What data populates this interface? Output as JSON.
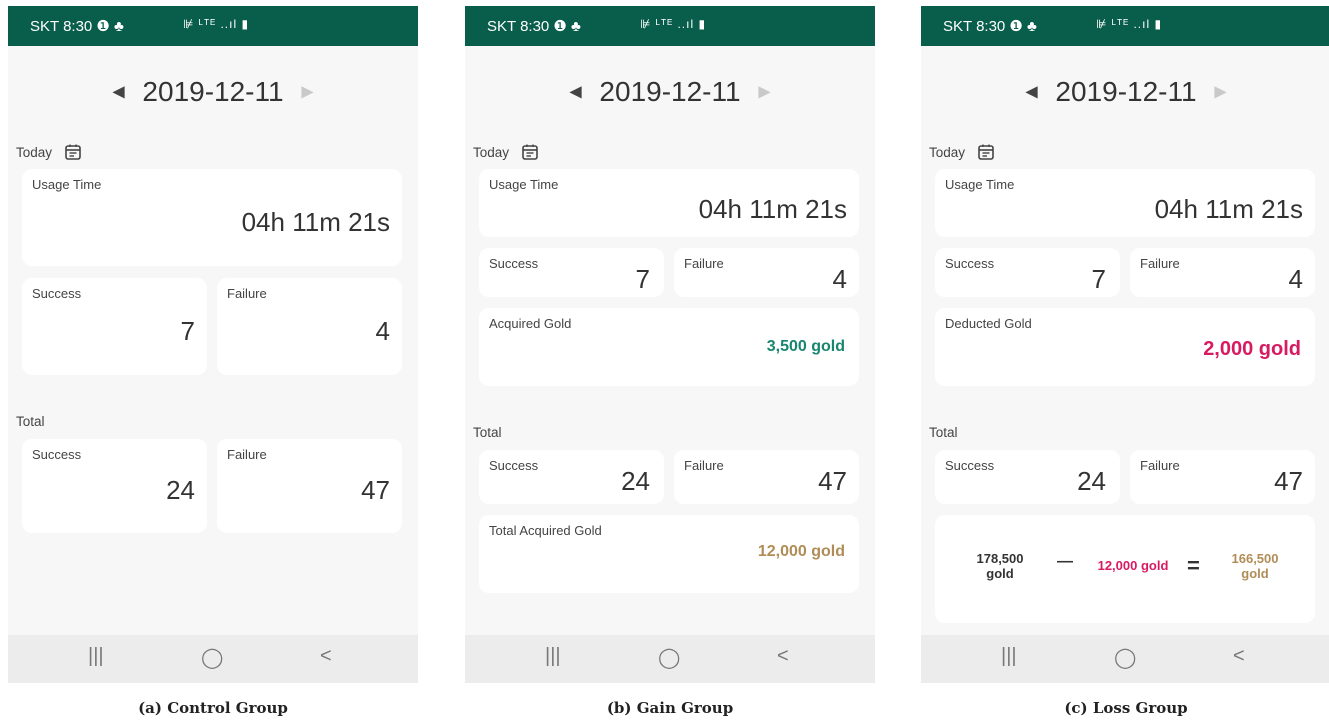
{
  "status_bar": {
    "carrier_time": "SKT 8:30 ❶ ♣",
    "icons": "⊯ ᴸᵀᴱ ..ıl ▮"
  },
  "nav": {
    "prev": "◀",
    "next": "▶",
    "date": "2019-12-11"
  },
  "labels": {
    "today": "Today",
    "total": "Total",
    "usage_time": "Usage Time",
    "success": "Success",
    "failure": "Failure"
  },
  "today_stats": {
    "usage_time": "04h 11m 21s",
    "success": "7",
    "failure": "4"
  },
  "total_stats": {
    "success": "24",
    "failure": "47"
  },
  "gain_group": {
    "acquired_label": "Acquired Gold",
    "acquired_value": "3,500 gold",
    "total_acquired_label": "Total Acquired Gold",
    "total_acquired_value": "12,000 gold"
  },
  "loss_group": {
    "deducted_label": "Deducted Gold",
    "deducted_value": "2,000 gold",
    "eq_left_1": "178,500",
    "eq_left_2": "gold",
    "eq_minus": "—",
    "eq_mid": "12,000 gold",
    "eq_equals": "=",
    "eq_right_1": "166,500",
    "eq_right_2": "gold"
  },
  "bottom_nav": {
    "recents": "|||",
    "home": "◯",
    "back": "<"
  },
  "captions": {
    "control": "(a) Control Group",
    "gain": "(b) Gain Group",
    "loss": "(c) Loss Group"
  },
  "colors": {
    "status_bar": "#085d4b",
    "gain_gold": "#17866f",
    "loss_red": "#d81b60",
    "total_gold": "#b08d57"
  }
}
